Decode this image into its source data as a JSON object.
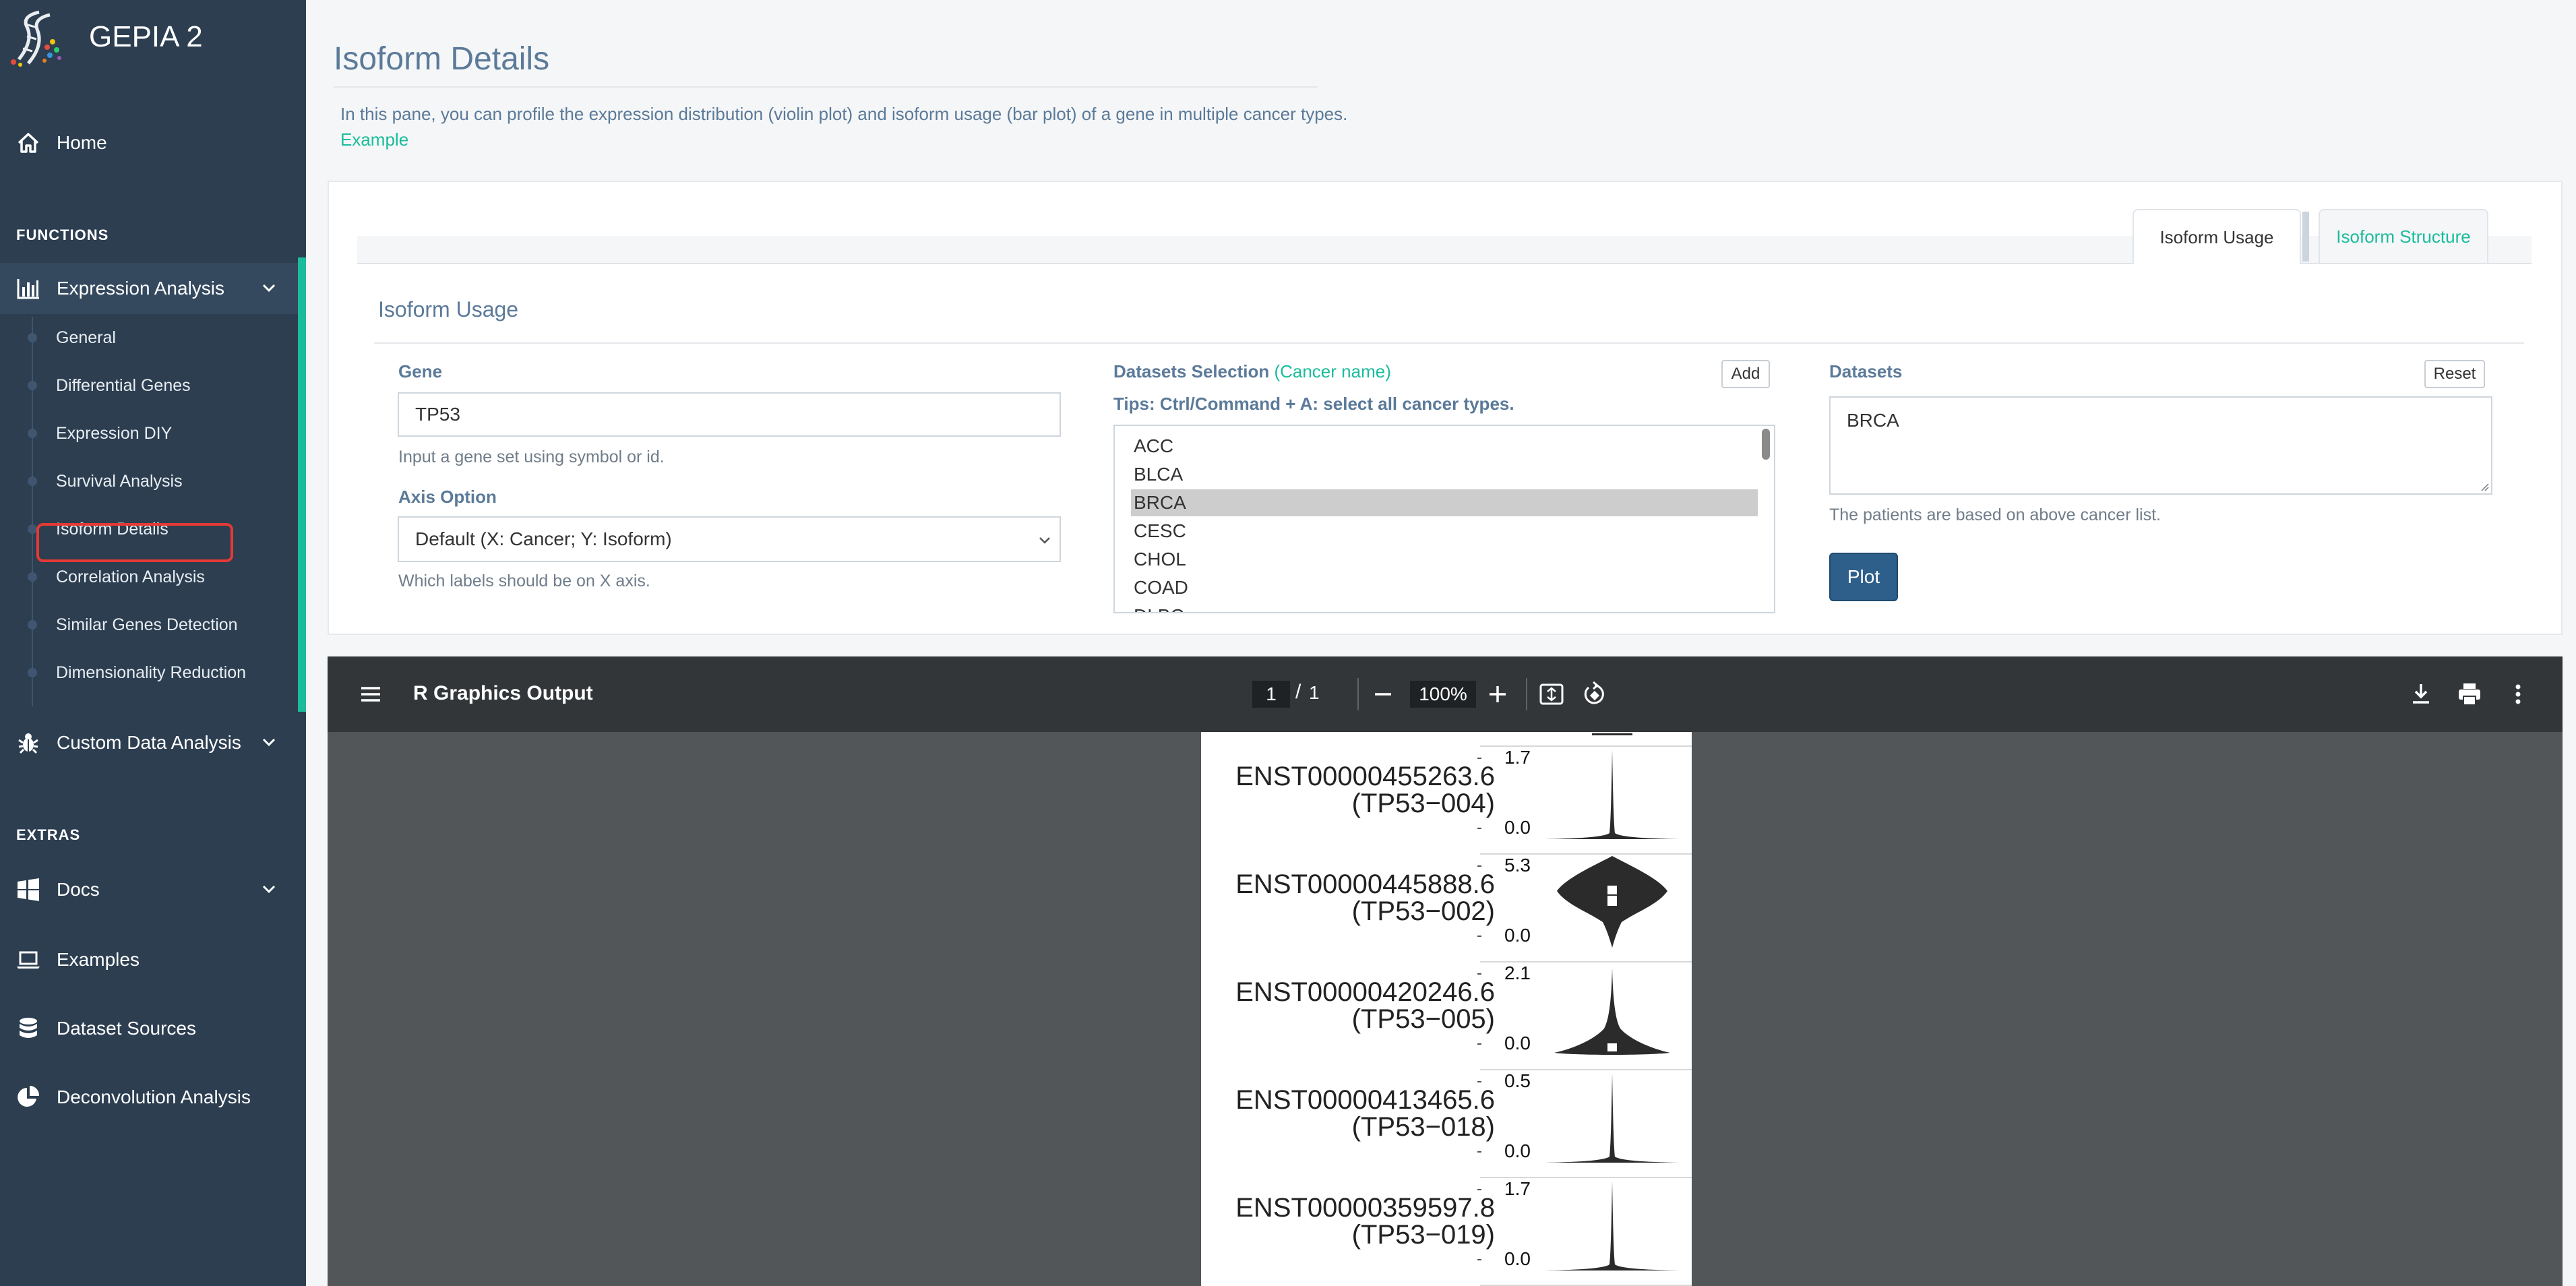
{
  "app": {
    "name": "GEPIA 2"
  },
  "sidebar": {
    "home": "Home",
    "functions_header": "FUNCTIONS",
    "expression_analysis": "Expression Analysis",
    "items": [
      {
        "label": "General"
      },
      {
        "label": "Differential Genes"
      },
      {
        "label": "Expression DIY"
      },
      {
        "label": "Survival Analysis"
      },
      {
        "label": "Isoform Details"
      },
      {
        "label": "Correlation Analysis"
      },
      {
        "label": "Similar Genes Detection"
      },
      {
        "label": "Dimensionality Reduction"
      }
    ],
    "custom_data": "Custom Data Analysis",
    "extras_header": "EXTRAS",
    "docs": "Docs",
    "examples": "Examples",
    "dataset_sources": "Dataset Sources",
    "deconvolution": "Deconvolution Analysis",
    "accent_color": "#1abc9c",
    "selection_color": "#e53935"
  },
  "page": {
    "title": "Isoform Details",
    "intro": "In this pane, you can profile the expression distribution (violin plot) and isoform usage (bar plot) of a gene in multiple cancer types.",
    "example_link": "Example"
  },
  "tabs": [
    {
      "label": "Isoform Usage",
      "active": true
    },
    {
      "label": "Isoform Structure",
      "active": false
    }
  ],
  "form": {
    "section_title": "Isoform Usage",
    "gene": {
      "label": "Gene",
      "value": "TP53",
      "help": "Input a gene set using symbol or id."
    },
    "axis": {
      "label": "Axis Option",
      "value": "Default (X: Cancer; Y: Isoform)",
      "help": "Which labels should be on X axis."
    },
    "datasets_selection": {
      "label": "Datasets Selection",
      "label_link": "(Cancer name)",
      "tips": "Tips: Ctrl/Command + A: select all cancer types.",
      "add_label": "Add",
      "options": [
        "ACC",
        "BLCA",
        "BRCA",
        "CESC",
        "CHOL",
        "COAD",
        "DLBC"
      ],
      "selected": "BRCA"
    },
    "datasets": {
      "label": "Datasets",
      "reset_label": "Reset",
      "value": "BRCA",
      "help": "The patients are based on above cancer list.",
      "plot_label": "Plot"
    }
  },
  "viewer": {
    "title": "R Graphics Output",
    "page_current": "1",
    "page_separator": "/",
    "page_total": "1",
    "zoom": "100%"
  },
  "plot_rows": [
    {
      "id": "ENST00000455263.6",
      "name": "(TP53−004)",
      "max": "1.7",
      "min": "0.0",
      "shape": "spike"
    },
    {
      "id": "ENST00000445888.6",
      "name": "(TP53−002)",
      "max": "5.3",
      "min": "0.0",
      "shape": "wide"
    },
    {
      "id": "ENST00000420246.6",
      "name": "(TP53−005)",
      "max": "2.1",
      "min": "0.0",
      "shape": "base"
    },
    {
      "id": "ENST00000413465.6",
      "name": "(TP53−018)",
      "max": "0.5",
      "min": "0.0",
      "shape": "spike"
    },
    {
      "id": "ENST00000359597.8",
      "name": "(TP53−019)",
      "max": "1.7",
      "min": "0.0",
      "shape": "spike"
    }
  ]
}
